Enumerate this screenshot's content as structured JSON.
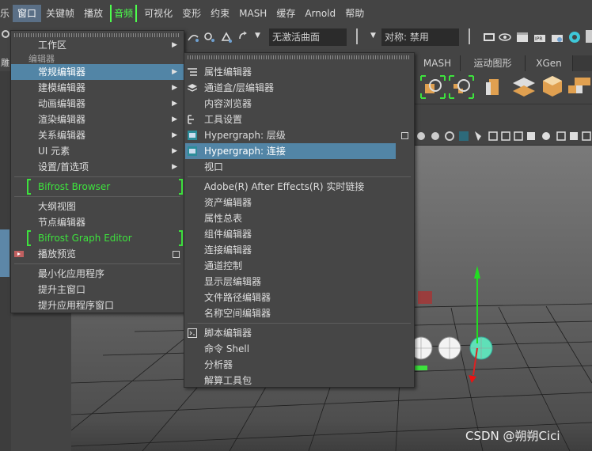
{
  "menubar": {
    "items": [
      {
        "label": "乐"
      },
      {
        "label": "窗口"
      },
      {
        "label": "关键帧"
      },
      {
        "label": "播放"
      },
      {
        "label": "音频"
      },
      {
        "label": "可视化"
      },
      {
        "label": "变形"
      },
      {
        "label": "约束"
      },
      {
        "label": "MASH"
      },
      {
        "label": "缓存"
      },
      {
        "label": "Arnold"
      },
      {
        "label": "帮助"
      }
    ]
  },
  "statusline": {
    "surface_field": "无激活曲面",
    "symmetry_field": "对称: 禁用"
  },
  "shelf": {
    "tabs": [
      "MASH",
      "运动图形",
      "XGen"
    ],
    "left_tab": "雕"
  },
  "window_menu": {
    "group_label": "编辑器",
    "items": [
      {
        "label": "工作区"
      },
      {
        "label": "常规编辑器"
      },
      {
        "label": "建模编辑器"
      },
      {
        "label": "动画编辑器"
      },
      {
        "label": "渲染编辑器"
      },
      {
        "label": "关系编辑器"
      },
      {
        "label": "UI 元素"
      },
      {
        "label": "设置/首选项"
      },
      {
        "label": "Bifrost Browser"
      },
      {
        "label": "大纲视图"
      },
      {
        "label": "节点编辑器"
      },
      {
        "label": "Bifrost Graph Editor"
      },
      {
        "label": "播放预览"
      },
      {
        "label": "最小化应用程序"
      },
      {
        "label": "提升主窗口"
      },
      {
        "label": "提升应用程序窗口"
      }
    ]
  },
  "general_editors_menu": {
    "items": [
      {
        "label": "属性编辑器"
      },
      {
        "label": "通道盒/层编辑器"
      },
      {
        "label": "内容浏览器"
      },
      {
        "label": "工具设置"
      },
      {
        "label": "Hypergraph: 层级"
      },
      {
        "label": "Hypergraph: 连接"
      },
      {
        "label": "视口"
      },
      {
        "label": "Adobe(R) After Effects(R) 实时链接"
      },
      {
        "label": "资产编辑器"
      },
      {
        "label": "属性总表"
      },
      {
        "label": "组件编辑器"
      },
      {
        "label": "连接编辑器"
      },
      {
        "label": "通道控制"
      },
      {
        "label": "显示层编辑器"
      },
      {
        "label": "文件路径编辑器"
      },
      {
        "label": "名称空间编辑器"
      },
      {
        "label": "脚本编辑器"
      },
      {
        "label": "命令 Shell"
      },
      {
        "label": "分析器"
      },
      {
        "label": "解算工具包"
      }
    ]
  },
  "watermark": "CSDN @朔朔Cici",
  "colors": {
    "highlight": "#5285a6",
    "green_text": "#3de23d",
    "menu_bg": "#464646"
  }
}
